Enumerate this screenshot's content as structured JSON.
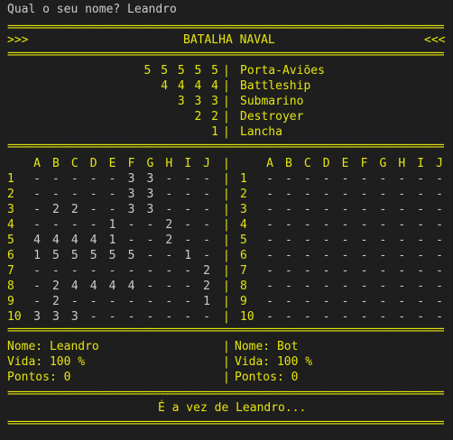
{
  "prompt": "Qual o seu nome? Leandro",
  "header": {
    "left": ">>>",
    "title": "BATALHA NAVAL",
    "right": "<<<"
  },
  "separator": "==================================================================================",
  "ships": [
    {
      "counts": "5 5 5 5 5",
      "name": "Porta-Aviões"
    },
    {
      "counts": "4 4 4 4",
      "name": "Battleship"
    },
    {
      "counts": "3 3 3",
      "name": "Submarino"
    },
    {
      "counts": "2 2",
      "name": "Destroyer"
    },
    {
      "counts": "1",
      "name": "Lancha"
    }
  ],
  "columns": [
    "A",
    "B",
    "C",
    "D",
    "E",
    "F",
    "G",
    "H",
    "I",
    "J"
  ],
  "rows": [
    "1",
    "2",
    "3",
    "4",
    "5",
    "6",
    "7",
    "8",
    "9",
    "10"
  ],
  "player_board": [
    [
      "-",
      "-",
      "-",
      "-",
      "-",
      "3",
      "3",
      "-",
      "-",
      "-"
    ],
    [
      "-",
      "-",
      "-",
      "-",
      "-",
      "3",
      "3",
      "-",
      "-",
      "-"
    ],
    [
      "-",
      "2",
      "2",
      "-",
      "-",
      "3",
      "3",
      "-",
      "-",
      "-"
    ],
    [
      "-",
      "-",
      "-",
      "-",
      "1",
      "-",
      "-",
      "2",
      "-",
      "-"
    ],
    [
      "4",
      "4",
      "4",
      "4",
      "1",
      "-",
      "-",
      "2",
      "-",
      "-"
    ],
    [
      "1",
      "5",
      "5",
      "5",
      "5",
      "5",
      "-",
      "-",
      "1",
      "-"
    ],
    [
      "-",
      "-",
      "-",
      "-",
      "-",
      "-",
      "-",
      "-",
      "-",
      "2"
    ],
    [
      "-",
      "2",
      "4",
      "4",
      "4",
      "4",
      "-",
      "-",
      "-",
      "2"
    ],
    [
      "-",
      "2",
      "-",
      "-",
      "-",
      "-",
      "-",
      "-",
      "-",
      "1"
    ],
    [
      "3",
      "3",
      "3",
      "-",
      "-",
      "-",
      "-",
      "-",
      "-",
      "-"
    ]
  ],
  "bot_board": [
    [
      "-",
      "-",
      "-",
      "-",
      "-",
      "-",
      "-",
      "-",
      "-",
      "-"
    ],
    [
      "-",
      "-",
      "-",
      "-",
      "-",
      "-",
      "-",
      "-",
      "-",
      "-"
    ],
    [
      "-",
      "-",
      "-",
      "-",
      "-",
      "-",
      "-",
      "-",
      "-",
      "-"
    ],
    [
      "-",
      "-",
      "-",
      "-",
      "-",
      "-",
      "-",
      "-",
      "-",
      "-"
    ],
    [
      "-",
      "-",
      "-",
      "-",
      "-",
      "-",
      "-",
      "-",
      "-",
      "-"
    ],
    [
      "-",
      "-",
      "-",
      "-",
      "-",
      "-",
      "-",
      "-",
      "-",
      "-"
    ],
    [
      "-",
      "-",
      "-",
      "-",
      "-",
      "-",
      "-",
      "-",
      "-",
      "-"
    ],
    [
      "-",
      "-",
      "-",
      "-",
      "-",
      "-",
      "-",
      "-",
      "-",
      "-"
    ],
    [
      "-",
      "-",
      "-",
      "-",
      "-",
      "-",
      "-",
      "-",
      "-",
      "-"
    ],
    [
      "-",
      "-",
      "-",
      "-",
      "-",
      "-",
      "-",
      "-",
      "-",
      "-"
    ]
  ],
  "divider": "|",
  "player": {
    "name_line": "Nome: Leandro",
    "life_line": "Vida: 100 %",
    "points_line": "Pontos: 0"
  },
  "bot": {
    "name_line": "Nome: Bot",
    "life_line": "Vida: 100 %",
    "points_line": "Pontos: 0"
  },
  "turn_message": "É a vez de Leandro...",
  "colors": {
    "background": "#1e1e1e",
    "text": "#cccccc",
    "accent": "#e5e510"
  }
}
